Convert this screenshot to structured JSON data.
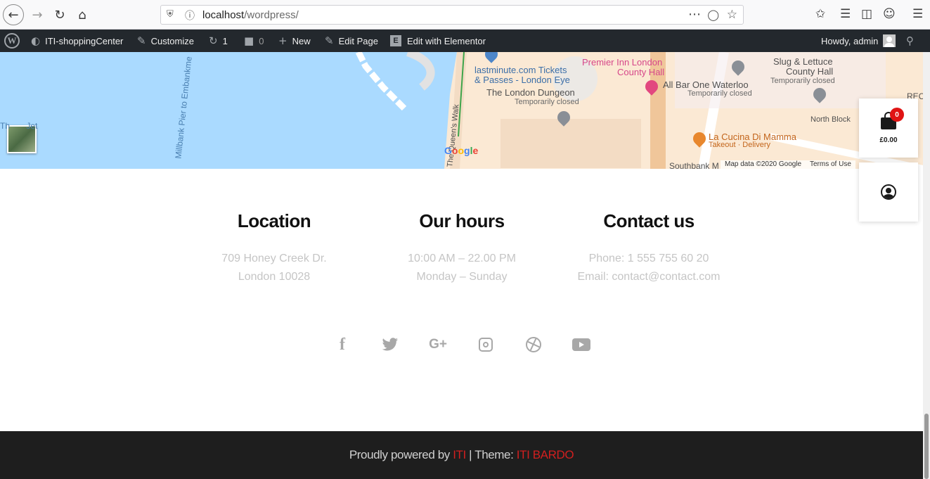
{
  "browser": {
    "url_host": "localhost",
    "url_path": "/wordpress/"
  },
  "admin_bar": {
    "site_name": "ITI-shoppingCenter",
    "customize": "Customize",
    "updates_count": "1",
    "comments_count": "0",
    "new": "New",
    "edit_page": "Edit Page",
    "edit_elementor": "Edit with Elementor",
    "howdy": "Howdy, admin"
  },
  "map": {
    "labels": {
      "thames_jet_a": "Th",
      "thames_jet_b": "Jet",
      "pier": "Millbank Pier to Embankme",
      "queens_walk": "The Queen's Walk",
      "lastminute_1": "lastminute.com Tickets",
      "lastminute_2": "& Passes - London Eye",
      "dungeon": "The London Dungeon",
      "dungeon_status": "Temporarily closed",
      "premier_1": "Premier Inn London",
      "premier_2": "County Hall",
      "allbar": "All Bar One Waterloo",
      "allbar_status": "Temporarily closed",
      "slug_1": "Slug & Lettuce",
      "slug_2": "County Hall",
      "slug_status": "Temporarily closed",
      "north_block": "North Block",
      "cucina": "La Cucina Di Mamma",
      "cucina_sub": "Takeout · Delivery",
      "southbank": "Southbank M",
      "rec": "REC"
    },
    "footer": {
      "map_data": "Map data ©2020 Google",
      "terms": "Terms of Use"
    }
  },
  "widgets": {
    "cart_count": "0",
    "cart_total": "£0.00"
  },
  "info": {
    "location": {
      "title": "Location",
      "line1": "709 Honey Creek Dr.",
      "line2": "London 10028"
    },
    "hours": {
      "title": "Our hours",
      "line1": "10:00 AM – 22.00 PM",
      "line2": "Monday – Sunday"
    },
    "contact": {
      "title": "Contact us",
      "line1": "Phone: 1 555 755 60 20",
      "line2": "Email: contact@contact.com"
    }
  },
  "social": [
    "facebook-icon",
    "twitter-icon",
    "google-plus-icon",
    "instagram-icon",
    "dribbble-icon",
    "youtube-icon"
  ],
  "footer": {
    "powered": "Proudly powered by",
    "iti": "ITI",
    "separator": "| Theme:",
    "theme": "ITI BARDO"
  },
  "colors": {
    "accent": "#d11f1f",
    "admin_bar": "#23282d",
    "footer_bg": "#1e1e1e",
    "water": "#aadaff",
    "muted_text": "#c5c5c5"
  }
}
